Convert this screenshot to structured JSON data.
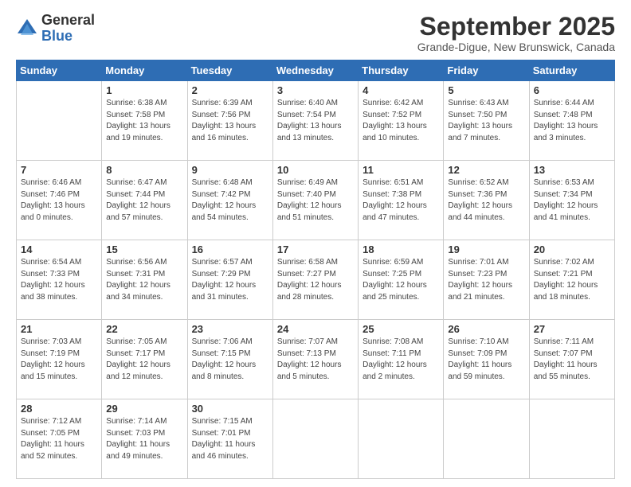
{
  "header": {
    "logo_general": "General",
    "logo_blue": "Blue",
    "month_title": "September 2025",
    "location": "Grande-Digue, New Brunswick, Canada"
  },
  "days_of_week": [
    "Sunday",
    "Monday",
    "Tuesday",
    "Wednesday",
    "Thursday",
    "Friday",
    "Saturday"
  ],
  "weeks": [
    [
      {
        "day": "",
        "sunrise": "",
        "sunset": "",
        "daylight": ""
      },
      {
        "day": "1",
        "sunrise": "Sunrise: 6:38 AM",
        "sunset": "Sunset: 7:58 PM",
        "daylight": "Daylight: 13 hours and 19 minutes."
      },
      {
        "day": "2",
        "sunrise": "Sunrise: 6:39 AM",
        "sunset": "Sunset: 7:56 PM",
        "daylight": "Daylight: 13 hours and 16 minutes."
      },
      {
        "day": "3",
        "sunrise": "Sunrise: 6:40 AM",
        "sunset": "Sunset: 7:54 PM",
        "daylight": "Daylight: 13 hours and 13 minutes."
      },
      {
        "day": "4",
        "sunrise": "Sunrise: 6:42 AM",
        "sunset": "Sunset: 7:52 PM",
        "daylight": "Daylight: 13 hours and 10 minutes."
      },
      {
        "day": "5",
        "sunrise": "Sunrise: 6:43 AM",
        "sunset": "Sunset: 7:50 PM",
        "daylight": "Daylight: 13 hours and 7 minutes."
      },
      {
        "day": "6",
        "sunrise": "Sunrise: 6:44 AM",
        "sunset": "Sunset: 7:48 PM",
        "daylight": "Daylight: 13 hours and 3 minutes."
      }
    ],
    [
      {
        "day": "7",
        "sunrise": "Sunrise: 6:46 AM",
        "sunset": "Sunset: 7:46 PM",
        "daylight": "Daylight: 13 hours and 0 minutes."
      },
      {
        "day": "8",
        "sunrise": "Sunrise: 6:47 AM",
        "sunset": "Sunset: 7:44 PM",
        "daylight": "Daylight: 12 hours and 57 minutes."
      },
      {
        "day": "9",
        "sunrise": "Sunrise: 6:48 AM",
        "sunset": "Sunset: 7:42 PM",
        "daylight": "Daylight: 12 hours and 54 minutes."
      },
      {
        "day": "10",
        "sunrise": "Sunrise: 6:49 AM",
        "sunset": "Sunset: 7:40 PM",
        "daylight": "Daylight: 12 hours and 51 minutes."
      },
      {
        "day": "11",
        "sunrise": "Sunrise: 6:51 AM",
        "sunset": "Sunset: 7:38 PM",
        "daylight": "Daylight: 12 hours and 47 minutes."
      },
      {
        "day": "12",
        "sunrise": "Sunrise: 6:52 AM",
        "sunset": "Sunset: 7:36 PM",
        "daylight": "Daylight: 12 hours and 44 minutes."
      },
      {
        "day": "13",
        "sunrise": "Sunrise: 6:53 AM",
        "sunset": "Sunset: 7:34 PM",
        "daylight": "Daylight: 12 hours and 41 minutes."
      }
    ],
    [
      {
        "day": "14",
        "sunrise": "Sunrise: 6:54 AM",
        "sunset": "Sunset: 7:33 PM",
        "daylight": "Daylight: 12 hours and 38 minutes."
      },
      {
        "day": "15",
        "sunrise": "Sunrise: 6:56 AM",
        "sunset": "Sunset: 7:31 PM",
        "daylight": "Daylight: 12 hours and 34 minutes."
      },
      {
        "day": "16",
        "sunrise": "Sunrise: 6:57 AM",
        "sunset": "Sunset: 7:29 PM",
        "daylight": "Daylight: 12 hours and 31 minutes."
      },
      {
        "day": "17",
        "sunrise": "Sunrise: 6:58 AM",
        "sunset": "Sunset: 7:27 PM",
        "daylight": "Daylight: 12 hours and 28 minutes."
      },
      {
        "day": "18",
        "sunrise": "Sunrise: 6:59 AM",
        "sunset": "Sunset: 7:25 PM",
        "daylight": "Daylight: 12 hours and 25 minutes."
      },
      {
        "day": "19",
        "sunrise": "Sunrise: 7:01 AM",
        "sunset": "Sunset: 7:23 PM",
        "daylight": "Daylight: 12 hours and 21 minutes."
      },
      {
        "day": "20",
        "sunrise": "Sunrise: 7:02 AM",
        "sunset": "Sunset: 7:21 PM",
        "daylight": "Daylight: 12 hours and 18 minutes."
      }
    ],
    [
      {
        "day": "21",
        "sunrise": "Sunrise: 7:03 AM",
        "sunset": "Sunset: 7:19 PM",
        "daylight": "Daylight: 12 hours and 15 minutes."
      },
      {
        "day": "22",
        "sunrise": "Sunrise: 7:05 AM",
        "sunset": "Sunset: 7:17 PM",
        "daylight": "Daylight: 12 hours and 12 minutes."
      },
      {
        "day": "23",
        "sunrise": "Sunrise: 7:06 AM",
        "sunset": "Sunset: 7:15 PM",
        "daylight": "Daylight: 12 hours and 8 minutes."
      },
      {
        "day": "24",
        "sunrise": "Sunrise: 7:07 AM",
        "sunset": "Sunset: 7:13 PM",
        "daylight": "Daylight: 12 hours and 5 minutes."
      },
      {
        "day": "25",
        "sunrise": "Sunrise: 7:08 AM",
        "sunset": "Sunset: 7:11 PM",
        "daylight": "Daylight: 12 hours and 2 minutes."
      },
      {
        "day": "26",
        "sunrise": "Sunrise: 7:10 AM",
        "sunset": "Sunset: 7:09 PM",
        "daylight": "Daylight: 11 hours and 59 minutes."
      },
      {
        "day": "27",
        "sunrise": "Sunrise: 7:11 AM",
        "sunset": "Sunset: 7:07 PM",
        "daylight": "Daylight: 11 hours and 55 minutes."
      }
    ],
    [
      {
        "day": "28",
        "sunrise": "Sunrise: 7:12 AM",
        "sunset": "Sunset: 7:05 PM",
        "daylight": "Daylight: 11 hours and 52 minutes."
      },
      {
        "day": "29",
        "sunrise": "Sunrise: 7:14 AM",
        "sunset": "Sunset: 7:03 PM",
        "daylight": "Daylight: 11 hours and 49 minutes."
      },
      {
        "day": "30",
        "sunrise": "Sunrise: 7:15 AM",
        "sunset": "Sunset: 7:01 PM",
        "daylight": "Daylight: 11 hours and 46 minutes."
      },
      {
        "day": "",
        "sunrise": "",
        "sunset": "",
        "daylight": ""
      },
      {
        "day": "",
        "sunrise": "",
        "sunset": "",
        "daylight": ""
      },
      {
        "day": "",
        "sunrise": "",
        "sunset": "",
        "daylight": ""
      },
      {
        "day": "",
        "sunrise": "",
        "sunset": "",
        "daylight": ""
      }
    ]
  ]
}
